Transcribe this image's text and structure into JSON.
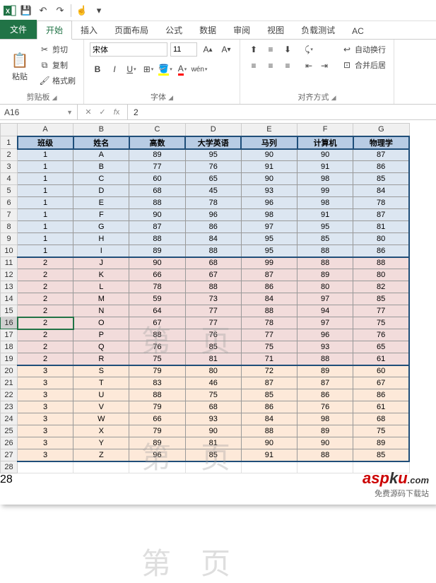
{
  "qat": {
    "save_tip": "保存",
    "undo_tip": "撤销",
    "redo_tip": "重做"
  },
  "tabs": {
    "file": "文件",
    "home": "开始",
    "insert": "插入",
    "layout": "页面布局",
    "formula": "公式",
    "data": "数据",
    "review": "审阅",
    "view": "视图",
    "load": "负载测试",
    "ac": "AC"
  },
  "ribbon": {
    "clipboard": {
      "paste": "粘贴",
      "cut": "剪切",
      "copy": "复制",
      "fmt": "格式刷",
      "label": "剪贴板"
    },
    "font": {
      "name": "宋体",
      "size": "11",
      "label": "字体"
    },
    "align": {
      "wrap": "自动换行",
      "merge": "合并后居",
      "label": "对齐方式"
    }
  },
  "namebox": "A16",
  "formula": "2",
  "columns": [
    "A",
    "B",
    "C",
    "D",
    "E",
    "F",
    "G"
  ],
  "headers": [
    "班级",
    "姓名",
    "高数",
    "大学英语",
    "马列",
    "计算机",
    "物理学"
  ],
  "rows": [
    {
      "n": 1,
      "g": 0,
      "c": [
        "班级",
        "姓名",
        "高数",
        "大学英语",
        "马列",
        "计算机",
        "物理学"
      ]
    },
    {
      "n": 2,
      "g": 1,
      "c": [
        "1",
        "A",
        "89",
        "95",
        "90",
        "90",
        "87"
      ]
    },
    {
      "n": 3,
      "g": 1,
      "c": [
        "1",
        "B",
        "77",
        "76",
        "91",
        "91",
        "86"
      ]
    },
    {
      "n": 4,
      "g": 1,
      "c": [
        "1",
        "C",
        "60",
        "65",
        "90",
        "98",
        "85"
      ]
    },
    {
      "n": 5,
      "g": 1,
      "c": [
        "1",
        "D",
        "68",
        "45",
        "93",
        "99",
        "84"
      ]
    },
    {
      "n": 6,
      "g": 1,
      "c": [
        "1",
        "E",
        "88",
        "78",
        "96",
        "98",
        "78"
      ]
    },
    {
      "n": 7,
      "g": 1,
      "c": [
        "1",
        "F",
        "90",
        "96",
        "98",
        "91",
        "87"
      ]
    },
    {
      "n": 8,
      "g": 1,
      "c": [
        "1",
        "G",
        "87",
        "86",
        "97",
        "95",
        "81"
      ]
    },
    {
      "n": 9,
      "g": 1,
      "c": [
        "1",
        "H",
        "88",
        "84",
        "95",
        "85",
        "80"
      ]
    },
    {
      "n": 10,
      "g": 1,
      "c": [
        "1",
        "I",
        "89",
        "88",
        "95",
        "88",
        "86"
      ]
    },
    {
      "n": 11,
      "g": 2,
      "c": [
        "2",
        "J",
        "90",
        "68",
        "99",
        "88",
        "88"
      ]
    },
    {
      "n": 12,
      "g": 2,
      "c": [
        "2",
        "K",
        "66",
        "67",
        "87",
        "89",
        "80"
      ]
    },
    {
      "n": 13,
      "g": 2,
      "c": [
        "2",
        "L",
        "78",
        "88",
        "86",
        "80",
        "82"
      ]
    },
    {
      "n": 14,
      "g": 2,
      "c": [
        "2",
        "M",
        "59",
        "73",
        "84",
        "97",
        "85"
      ]
    },
    {
      "n": 15,
      "g": 2,
      "c": [
        "2",
        "N",
        "64",
        "77",
        "88",
        "94",
        "77"
      ]
    },
    {
      "n": 16,
      "g": 2,
      "c": [
        "2",
        "O",
        "67",
        "77",
        "78",
        "97",
        "75"
      ]
    },
    {
      "n": 17,
      "g": 2,
      "c": [
        "2",
        "P",
        "88",
        "76",
        "77",
        "96",
        "76"
      ]
    },
    {
      "n": 18,
      "g": 2,
      "c": [
        "2",
        "Q",
        "76",
        "85",
        "75",
        "93",
        "65"
      ]
    },
    {
      "n": 19,
      "g": 2,
      "c": [
        "2",
        "R",
        "75",
        "81",
        "71",
        "88",
        "61"
      ]
    },
    {
      "n": 20,
      "g": 3,
      "c": [
        "3",
        "S",
        "79",
        "80",
        "72",
        "89",
        "60"
      ]
    },
    {
      "n": 21,
      "g": 3,
      "c": [
        "3",
        "T",
        "83",
        "46",
        "87",
        "87",
        "67"
      ]
    },
    {
      "n": 22,
      "g": 3,
      "c": [
        "3",
        "U",
        "88",
        "75",
        "85",
        "86",
        "86"
      ]
    },
    {
      "n": 23,
      "g": 3,
      "c": [
        "3",
        "V",
        "79",
        "68",
        "86",
        "76",
        "61"
      ]
    },
    {
      "n": 24,
      "g": 3,
      "c": [
        "3",
        "W",
        "66",
        "93",
        "84",
        "98",
        "68"
      ]
    },
    {
      "n": 25,
      "g": 3,
      "c": [
        "3",
        "X",
        "79",
        "90",
        "88",
        "89",
        "75"
      ]
    },
    {
      "n": 26,
      "g": 3,
      "c": [
        "3",
        "Y",
        "89",
        "81",
        "90",
        "90",
        "89"
      ]
    },
    {
      "n": 27,
      "g": 3,
      "c": [
        "3",
        "Z",
        "96",
        "85",
        "91",
        "88",
        "85"
      ]
    }
  ],
  "sel": {
    "row": 16,
    "col": 0
  },
  "watermark": {
    "l": "第",
    "r": "页"
  },
  "logo": {
    "a": "asp",
    "b": "k",
    "c": "u",
    "d": ".com",
    "sub": "免费源码下载站"
  }
}
